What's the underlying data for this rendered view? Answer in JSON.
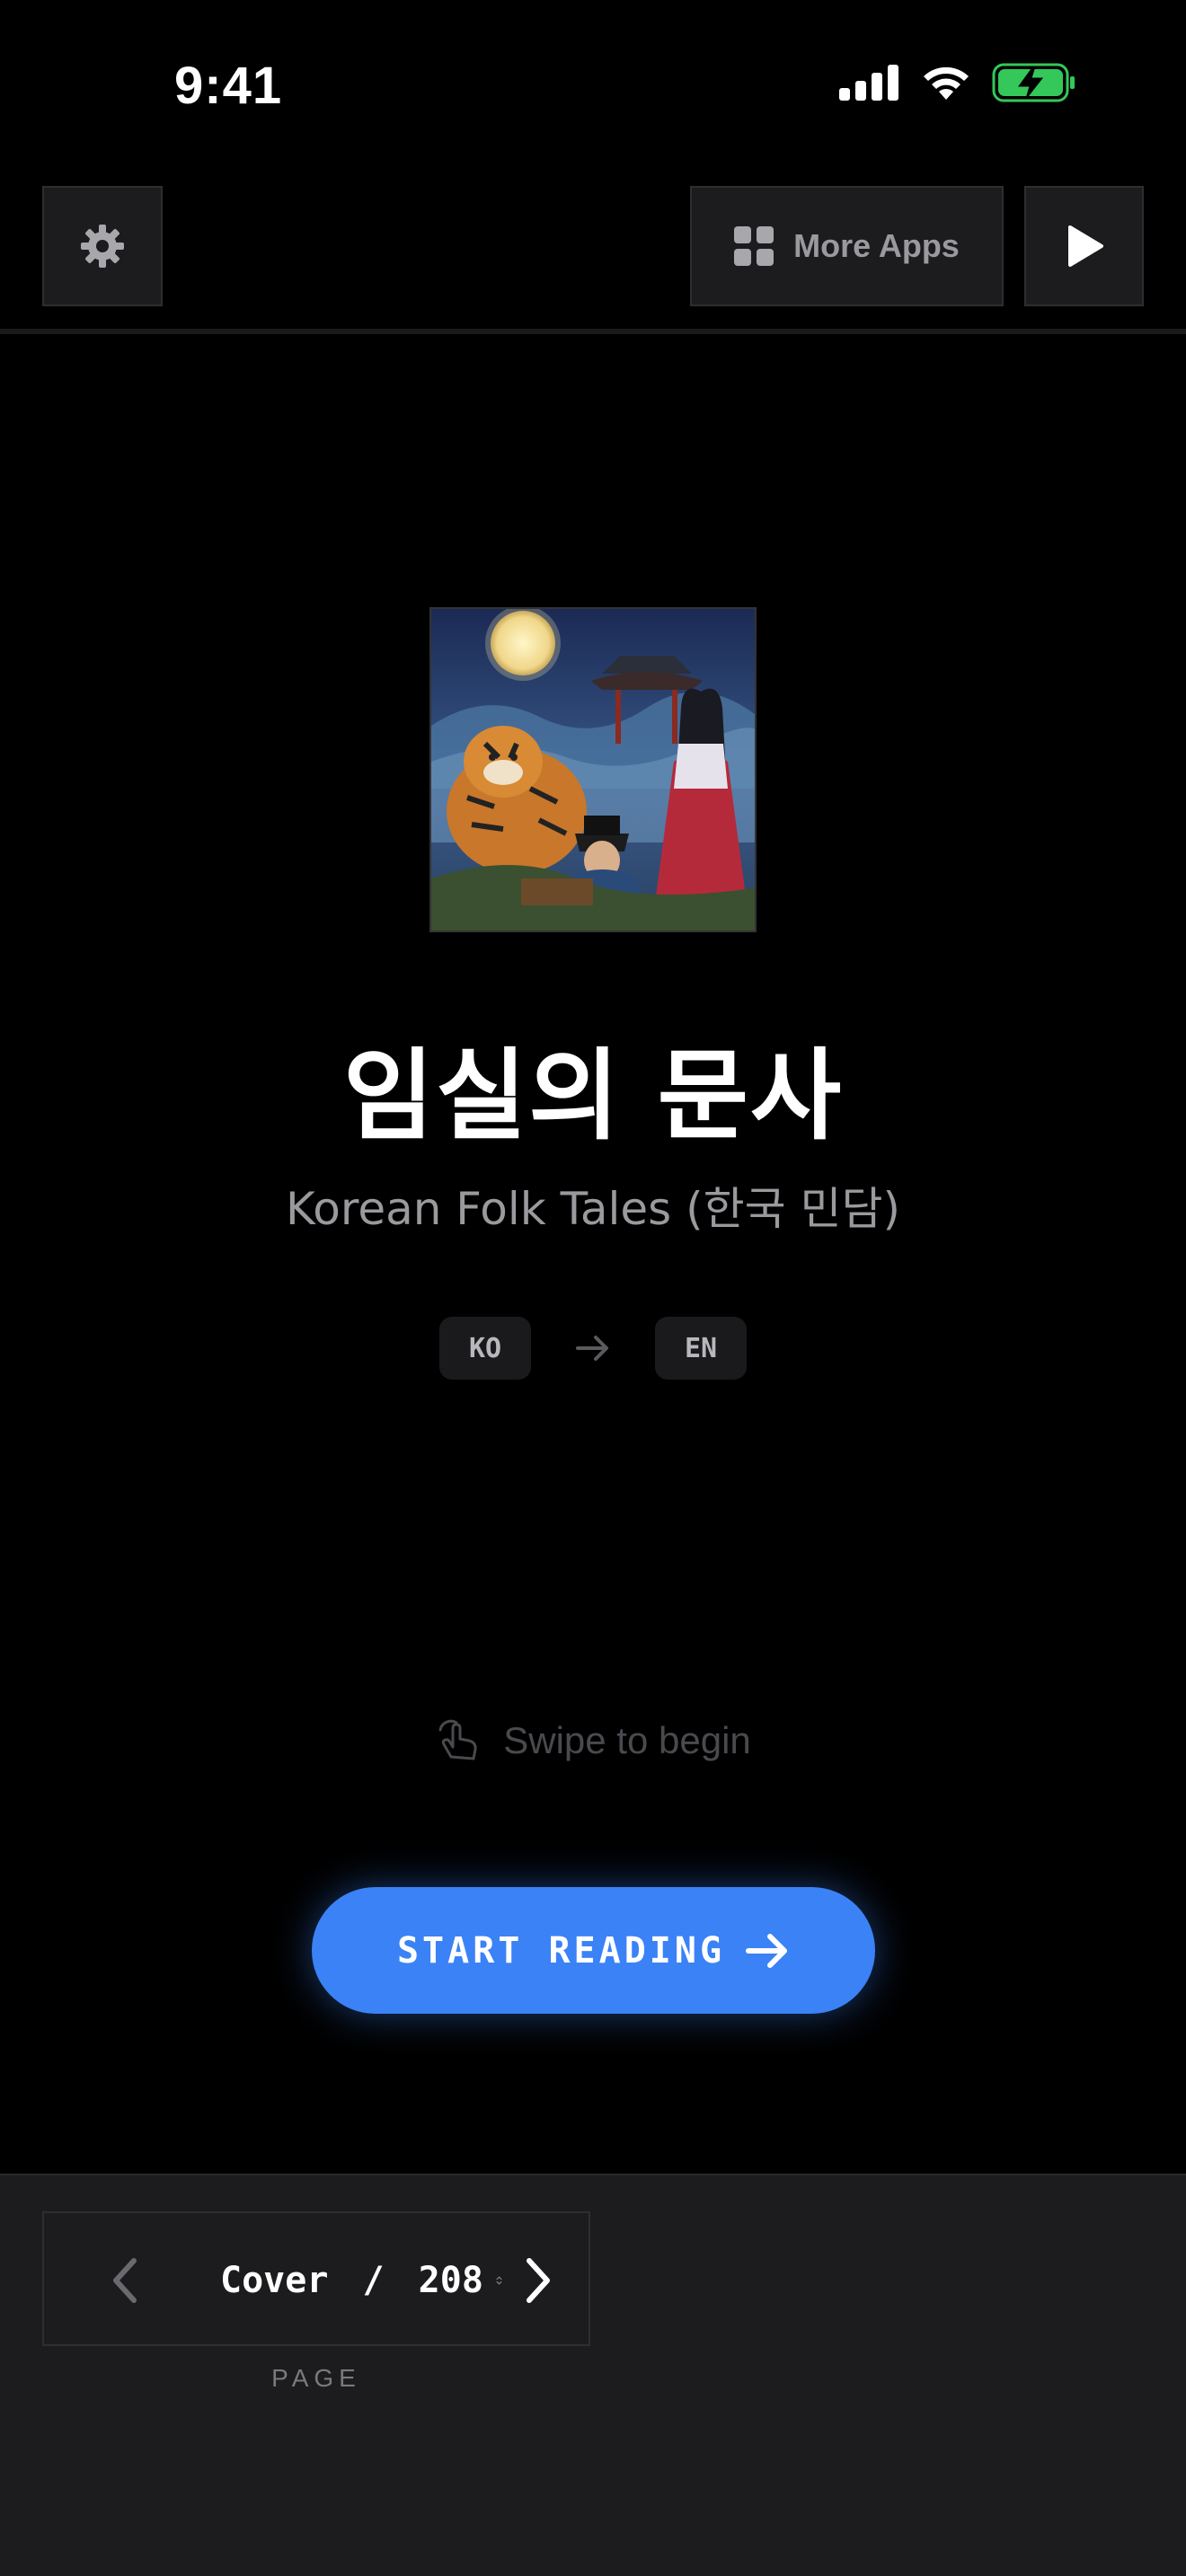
{
  "status_bar": {
    "time": "9:41",
    "icons": [
      "cellular-signal-icon",
      "wifi-icon",
      "battery-charging-icon"
    ],
    "battery_color": "#34c759"
  },
  "toolbar": {
    "settings_icon": "gear-icon",
    "more_apps_label": "More Apps",
    "more_apps_icon": "grid-icon",
    "play_icon": "play-icon"
  },
  "book": {
    "title": "임실의 문사",
    "subtitle": "Korean Folk Tales (한국 민담)",
    "source_lang": "KO",
    "target_lang": "EN"
  },
  "swipe_hint": {
    "icon": "tap-hand-icon",
    "label": "Swipe to begin"
  },
  "start_button": {
    "label": "START READING",
    "color": "#3b82f6"
  },
  "pager": {
    "current": "Cover",
    "separator": " / ",
    "total": "208",
    "caption": "PAGE"
  }
}
